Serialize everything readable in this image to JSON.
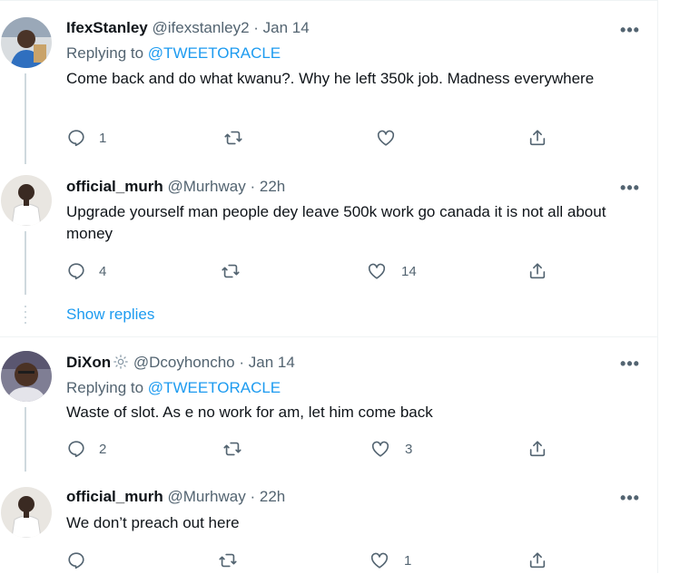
{
  "tweets": [
    {
      "name": "IfexStanley",
      "handle": "@ifexstanley2",
      "time": "Jan 14",
      "replying_label": "Replying to",
      "replying_to": "@TWEETORACLE",
      "text": "Come back and do what kwanu?.  Why he left 350k job. Madness everywhere",
      "reply_count": "1",
      "retweet_count": "",
      "like_count": ""
    },
    {
      "name": "official_murh",
      "handle": "@Murhway",
      "time": "22h",
      "text": "Upgrade yourself man people dey leave 500k work go canada it is not all about money",
      "reply_count": "4",
      "retweet_count": "",
      "like_count": "14"
    },
    {
      "name": "DiXon",
      "handle": "@Dcoyhoncho",
      "time": "Jan 14",
      "replying_label": "Replying to",
      "replying_to": "@TWEETORACLE",
      "text": "Waste of slot.  As e no work for am, let him come back",
      "reply_count": "2",
      "retweet_count": "",
      "like_count": "3"
    },
    {
      "name": "official_murh",
      "handle": "@Murhway",
      "time": "22h",
      "text": "We don’t preach out here",
      "reply_count": "",
      "retweet_count": "",
      "like_count": "1"
    }
  ],
  "show_replies": "Show replies",
  "separator": "·",
  "more_glyph": "•••",
  "colors": {
    "accent": "#1d9bf0",
    "text": "#0f1419",
    "muted": "#536471",
    "border": "#eff3f4",
    "thread_line": "#cfd9de"
  }
}
